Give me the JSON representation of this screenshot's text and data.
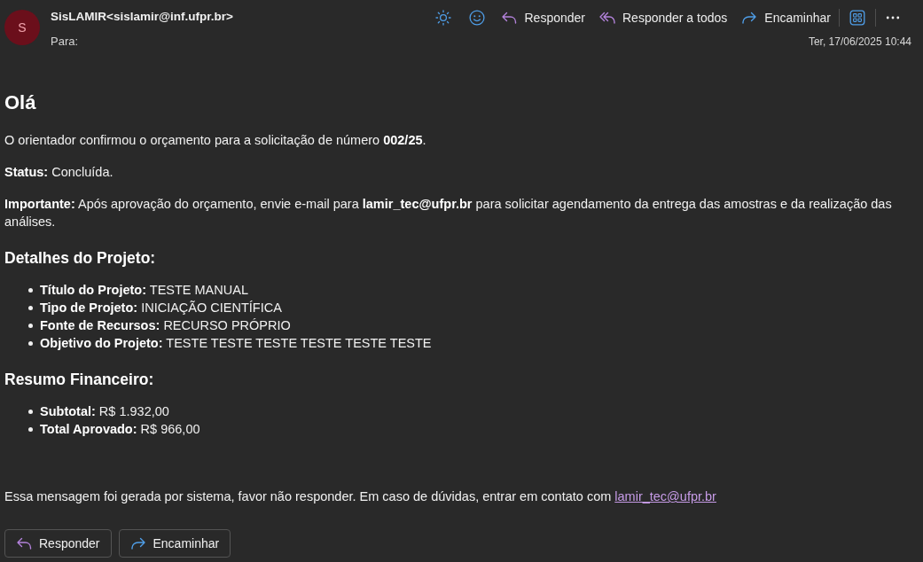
{
  "header": {
    "avatar": "S",
    "sender": "SisLAMIR<sislamir@inf.ufpr.br>",
    "to_label": "Para:",
    "actions": [
      {
        "kind": "reply",
        "label": "Responder"
      },
      {
        "kind": "reply_all",
        "label": "Responder a todos"
      },
      {
        "kind": "forward",
        "label": "Encaminhar"
      }
    ],
    "date": "Ter, 17/06/2025 10:44"
  },
  "body": {
    "greeting": "Olá",
    "paragraphs": [
      "O orientador confirmou o orçamento para a solicitação de número **002/25**.",
      "**Status:** Concluída.",
      "**Importante:** Após aprovação do orçamento, envie e-mail para **lamir_tec@ufpr.br** para solicitar agendamento da entrega das amostras e da realização das análises."
    ],
    "sections": [
      {
        "heading": "Detalhes do Projeto:",
        "items": [
          "**Título do Projeto:** TESTE MANUAL",
          "**Tipo de Projeto:** INICIAÇÃO CIENTÍFICA",
          "**Fonte de Recursos:** RECURSO PRÓPRIO",
          "**Objetivo do Projeto:** TESTE TESTE TESTE TESTE TESTE TESTE"
        ]
      },
      {
        "heading": "Resumo Financeiro:",
        "items": [
          "**Subtotal:** R$ 1.932,00",
          "**Total Aprovado:** R$ 966,00"
        ]
      }
    ],
    "footer": {
      "text": "Essa mensagem foi gerada por sistema, favor não responder. Em caso de dúvidas, entrar em contato com",
      "link": "lamir_tec@ufpr.br"
    }
  },
  "bottom_buttons": [
    {
      "kind": "reply",
      "label": "Responder"
    },
    {
      "kind": "forward",
      "label": "Encaminhar"
    }
  ]
}
